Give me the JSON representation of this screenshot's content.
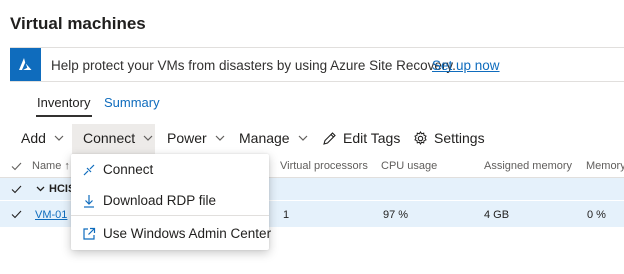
{
  "header": {
    "title": "Virtual machines"
  },
  "banner": {
    "icon": "azure-logo-icon",
    "accent_color": "#0f6cbd",
    "text": "Help protect your VMs from disasters by using Azure Site Recovery.",
    "link": "Set up now"
  },
  "tabs": [
    {
      "label": "Inventory",
      "active": true
    },
    {
      "label": "Summary",
      "active": false
    }
  ],
  "toolbar": {
    "add": "Add",
    "connect": "Connect",
    "power": "Power",
    "manage": "Manage",
    "edit_tags": "Edit Tags",
    "settings": "Settings"
  },
  "table": {
    "columns": {
      "name": "Name",
      "sort_indicator": "↑",
      "virtual_processors": "Virtual processors",
      "cpu_usage": "CPU usage",
      "assigned_memory": "Assigned memory",
      "memory": "Memory"
    },
    "group": {
      "label": "HCIS"
    },
    "rows": [
      {
        "name": "VM-01",
        "virtual_processors": "1",
        "cpu_usage": "97 %",
        "assigned_memory": "4 GB",
        "memory": "0 %"
      }
    ]
  },
  "connect_menu": {
    "items": [
      {
        "label": "Connect",
        "icon": "connect-plug-icon"
      },
      {
        "label": "Download RDP file",
        "icon": "download-icon"
      },
      {
        "label": "Use Windows Admin Center",
        "icon": "open-external-icon"
      }
    ]
  },
  "colors": {
    "selected_row": "#e5f1fb",
    "link": "#0f6cbd",
    "toolbar_active": "#edebe9"
  }
}
